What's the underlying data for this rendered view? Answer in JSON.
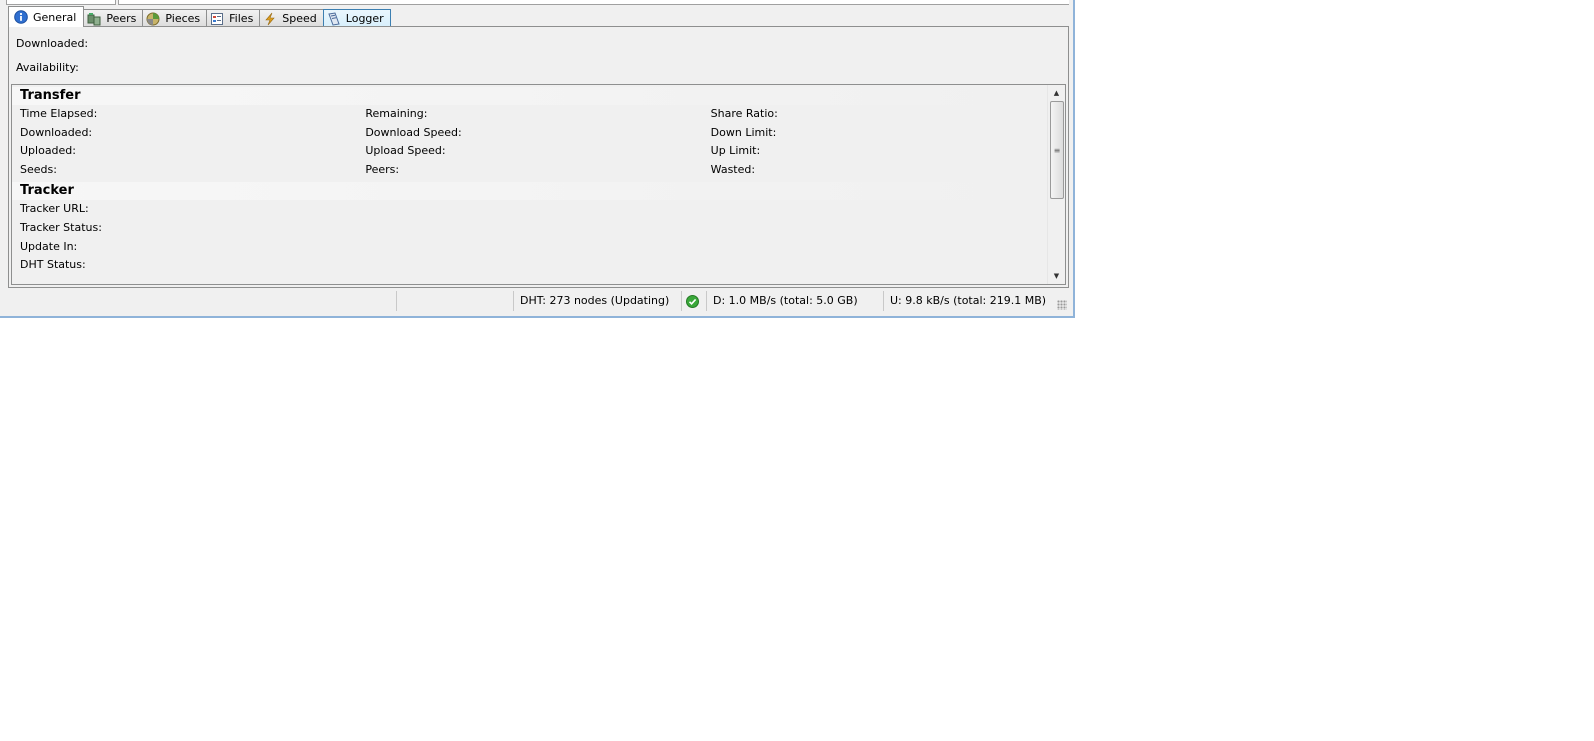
{
  "tabs": [
    {
      "label": "General",
      "icon": "info-icon",
      "active": true
    },
    {
      "label": "Peers",
      "icon": "peers-icon"
    },
    {
      "label": "Pieces",
      "icon": "pieces-icon"
    },
    {
      "label": "Files",
      "icon": "files-icon"
    },
    {
      "label": "Speed",
      "icon": "speed-icon"
    },
    {
      "label": "Logger",
      "icon": "logger-icon"
    }
  ],
  "general": {
    "downloaded_label": "Downloaded:",
    "availability_label": "Availability:"
  },
  "transfer": {
    "header": "Transfer",
    "rows": [
      [
        "Time Elapsed:",
        "Remaining:",
        "Share Ratio:"
      ],
      [
        "Downloaded:",
        "Download Speed:",
        "Down Limit:"
      ],
      [
        "Uploaded:",
        "Upload Speed:",
        "Up Limit:"
      ],
      [
        "Seeds:",
        "Peers:",
        "Wasted:"
      ]
    ]
  },
  "tracker": {
    "header": "Tracker",
    "rows": [
      "Tracker URL:",
      "Tracker Status:",
      "Update In:",
      "DHT Status:"
    ]
  },
  "statusbar": {
    "dht": "DHT: 273 nodes (Updating)",
    "download": "D: 1.0 MB/s  (total: 5.0 GB)",
    "upload": "U: 9.8 kB/s  (total: 219.1 MB)",
    "status_icon": "check-circle-icon",
    "status_color": "#3aa83a"
  }
}
